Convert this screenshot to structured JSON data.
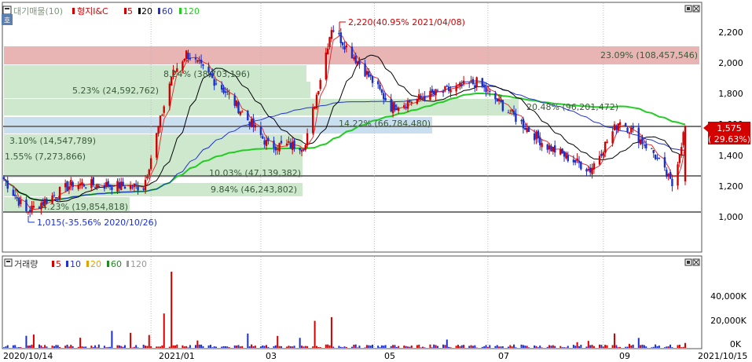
{
  "price_panel": {
    "title": "대기매물(10)",
    "legend": [
      {
        "label": "형지I&C",
        "color": "#d40000"
      },
      {
        "label": "5",
        "color": "#e03131"
      },
      {
        "label": "20",
        "color": "#000000"
      },
      {
        "label": "60",
        "color": "#2233cc"
      },
      {
        "label": "120",
        "color": "#22cc22"
      }
    ],
    "current_price": "1,575",
    "current_change": "( 29.63%)",
    "y_ticks": [
      "2,200",
      "2,000",
      "1,800",
      "1,600",
      "1,400",
      "1,200",
      "1,000"
    ],
    "annotations": {
      "high": "2,220(40.95% 2021/04/08)",
      "low": "1,015(-35.56% 2020/10/26)"
    }
  },
  "supply_bands": [
    {
      "label": "23.09% (108,457,546)",
      "color": "#e8b4b4"
    },
    {
      "label": "8.24% (38,703,196)",
      "color": "#cde8cd"
    },
    {
      "label": "5.23% (24,592,762)",
      "color": "#cde8cd"
    },
    {
      "label": "20.48% (96,201,472)",
      "color": "#cde8cd"
    },
    {
      "label": "14.22% (66,784,480)",
      "color": "#c9dff0"
    },
    {
      "label": "3.10% (14,547,789)",
      "color": "#cde8cd"
    },
    {
      "label": "1.55% (7,273,866)",
      "color": "#cde8cd"
    },
    {
      "label": "10.03% (47,139,382)",
      "color": "#cde8cd"
    },
    {
      "label": "9.84% (46,243,802)",
      "color": "#cde8cd"
    },
    {
      "label": "4.23% (19,854,818)",
      "color": "#cde8cd"
    }
  ],
  "volume_panel": {
    "title": "거래량",
    "legend": [
      {
        "label": "5",
        "color": "#d40000"
      },
      {
        "label": "10",
        "color": "#2233cc"
      },
      {
        "label": "20",
        "color": "#e8a000"
      },
      {
        "label": "60",
        "color": "#228822"
      },
      {
        "label": "120",
        "color": "#999999"
      }
    ],
    "y_ticks": [
      "40,000K",
      "20,000K",
      "0K"
    ]
  },
  "x_axis": {
    "labels": [
      "2020/10/14",
      "2021/01",
      "03",
      "05",
      "07",
      "09",
      "2021/10/15"
    ]
  },
  "colors": {
    "up": "#d40000",
    "down": "#1a2fd0",
    "ma5": "#e03131",
    "ma20": "#000000",
    "ma60": "#2233cc",
    "ma120": "#22cc22"
  },
  "chart_data": {
    "type": "candlestick",
    "title": "형지I&C",
    "x_range": [
      "2020/10/14",
      "2021/10/15"
    ],
    "ylim": [
      900,
      2300
    ],
    "price_checkpoints": [
      {
        "date": "2020/10/14",
        "price": 1230
      },
      {
        "date": "2020/10/26",
        "price": 1015
      },
      {
        "date": "2020/11/20",
        "price": 1200
      },
      {
        "date": "2020/12/28",
        "price": 1180
      },
      {
        "date": "2021/01/12",
        "price": 1900
      },
      {
        "date": "2021/01/20",
        "price": 2050
      },
      {
        "date": "2021/02/10",
        "price": 1800
      },
      {
        "date": "2021/03/05",
        "price": 1450
      },
      {
        "date": "2021/03/25",
        "price": 1450
      },
      {
        "date": "2021/04/08",
        "price": 2220
      },
      {
        "date": "2021/04/25",
        "price": 1950
      },
      {
        "date": "2021/05/10",
        "price": 1700
      },
      {
        "date": "2021/06/01",
        "price": 1780
      },
      {
        "date": "2021/06/25",
        "price": 1860
      },
      {
        "date": "2021/07/05",
        "price": 1750
      },
      {
        "date": "2021/08/01",
        "price": 1450
      },
      {
        "date": "2021/08/25",
        "price": 1290
      },
      {
        "date": "2021/09/10",
        "price": 1620
      },
      {
        "date": "2021/09/28",
        "price": 1400
      },
      {
        "date": "2021/10/08",
        "price": 1190
      },
      {
        "date": "2021/10/15",
        "price": 1575
      }
    ],
    "horizontal_lines": [
      1575,
      1250,
      1015
    ],
    "moving_averages": [
      "5",
      "20",
      "60",
      "120"
    ],
    "volume_unit": "K",
    "volume_spikes": [
      {
        "date": "2021/01/12",
        "value": 62000
      },
      {
        "date": "2021/01/08",
        "value": 28000
      },
      {
        "date": "2021/03/30",
        "value": 22000
      },
      {
        "date": "2021/04/08",
        "value": 25000
      },
      {
        "date": "2020/10/26",
        "value": 15000
      },
      {
        "date": "2021/10/15",
        "value": 4000
      }
    ]
  }
}
